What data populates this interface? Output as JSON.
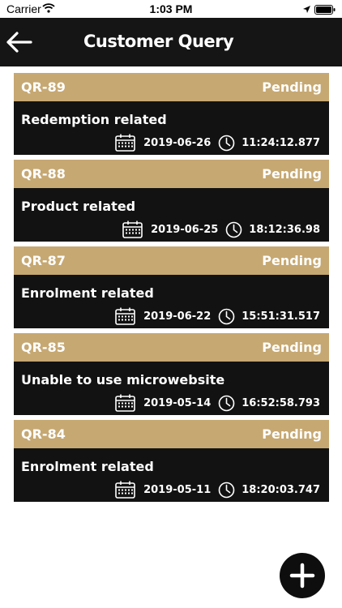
{
  "status_bar": {
    "carrier": "Carrier",
    "time": "1:03 PM"
  },
  "header": {
    "title": "Customer Query"
  },
  "queries": [
    {
      "id": "QR-89",
      "status": "Pending",
      "subject": "Redemption related",
      "date": "2019-06-26",
      "time": "11:24:12.877"
    },
    {
      "id": "QR-88",
      "status": "Pending",
      "subject": "Product related",
      "date": "2019-06-25",
      "time": "18:12:36.98"
    },
    {
      "id": "QR-87",
      "status": "Pending",
      "subject": "Enrolment related",
      "date": "2019-06-22",
      "time": "15:51:31.517"
    },
    {
      "id": "QR-85",
      "status": "Pending",
      "subject": "Unable to use microwebsite",
      "date": "2019-05-14",
      "time": "16:52:58.793"
    },
    {
      "id": "QR-84",
      "status": "Pending",
      "subject": "Enrolment related",
      "date": "2019-05-11",
      "time": "18:20:03.747"
    }
  ],
  "icons": {
    "back": "arrow-left-icon",
    "calendar": "calendar-icon",
    "clock": "clock-icon",
    "add": "plus-icon"
  },
  "colors": {
    "header_bg": "#151515",
    "card_header": "#c6a872",
    "card_body": "#121212",
    "text": "#ffffff"
  }
}
